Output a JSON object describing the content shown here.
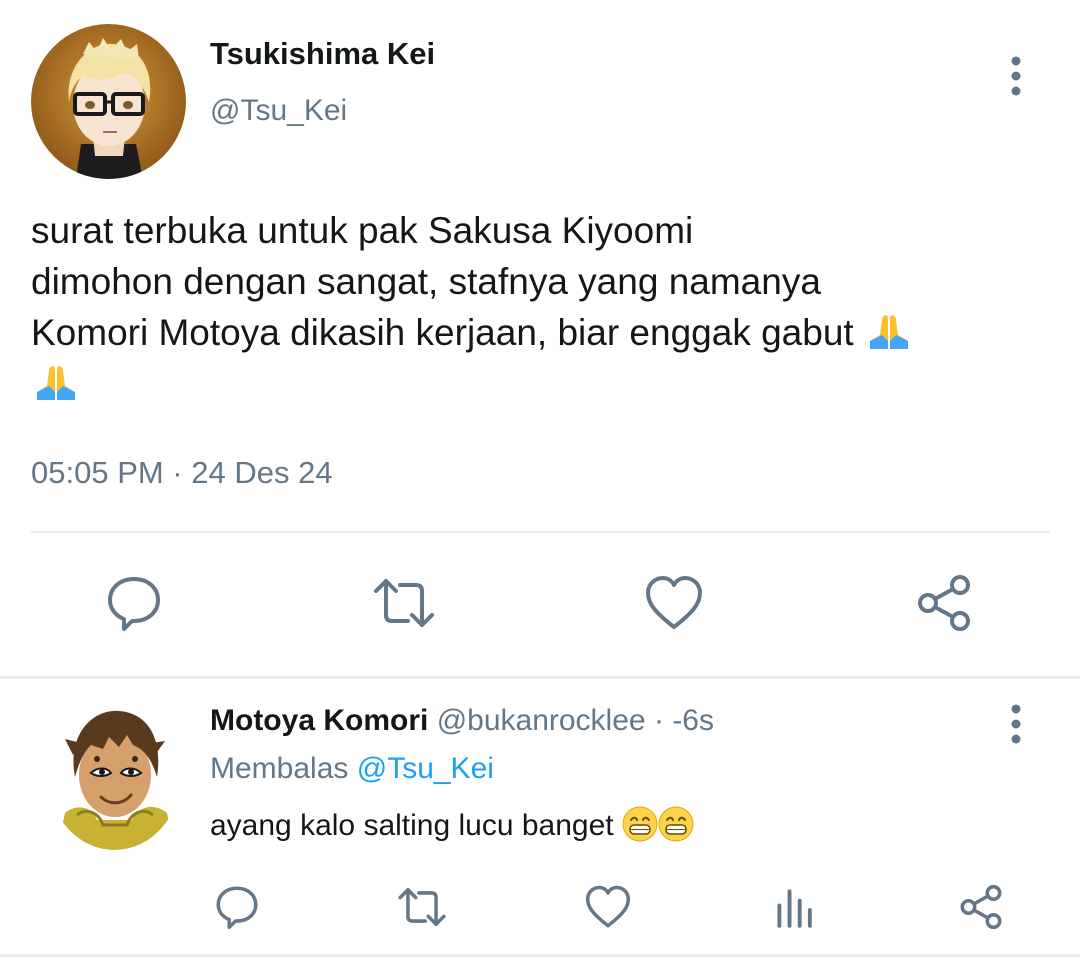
{
  "tweet": {
    "author_name": "Tsukishima Kei",
    "author_handle": "@Tsu_Kei",
    "text_lines": [
      "surat terbuka untuk pak Sakusa Kiyoomi",
      "dimohon dengan sangat, stafnya yang namanya",
      "Komori Motoya dikasih kerjaan, biar enggak gabut "
    ],
    "timestamp": "05:05 PM · 24 Des 24",
    "actions": [
      "reply-icon",
      "retweet-icon",
      "like-icon",
      "share-icon"
    ],
    "more_icon": "more-vertical-icon",
    "emoji": "folded-hands"
  },
  "reply": {
    "author_name": "Motoya Komori",
    "author_handle": "@bukanrocklee",
    "time_ago": "· -6s",
    "replying_prefix": "Membalas",
    "replying_to": "@Tsu_Kei",
    "text": "ayang kalo salting lucu banget ",
    "emoji": "grinning-face",
    "actions": [
      "reply-icon",
      "retweet-icon",
      "like-icon",
      "analytics-icon",
      "share-icon"
    ]
  },
  "colors": {
    "text_primary": "#14171a",
    "text_secondary": "#657786",
    "link": "#1da1f2",
    "divider": "#e6ecf0"
  }
}
